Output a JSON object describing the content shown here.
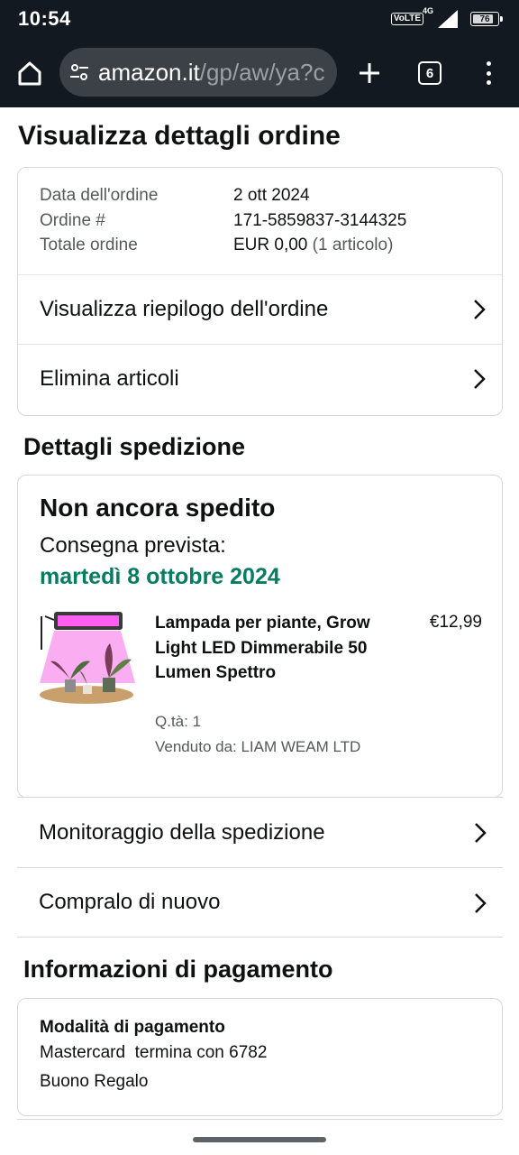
{
  "status_bar": {
    "time": "10:54",
    "volte": "VoLTE",
    "network": "4G",
    "battery": "76"
  },
  "browser": {
    "url_host": "amazon.it",
    "url_path": "/gp/aw/ya?c",
    "tab_count": "6",
    "icons": [
      "home-icon",
      "tune-icon",
      "plus-icon",
      "tabs-icon",
      "more-vert-icon"
    ]
  },
  "page": {
    "title": "Visualizza dettagli ordine"
  },
  "order": {
    "date_label": "Data dell'ordine",
    "date_value": "2 ott 2024",
    "number_label": "Ordine #",
    "number_value": "171-5859837-3144325",
    "total_label": "Totale ordine",
    "total_value": "EUR 0,00",
    "total_items": "(1 articolo)",
    "summary_link": "Visualizza riepilogo dell'ordine",
    "delete_link": "Elimina articoli"
  },
  "shipment": {
    "section_title": "Dettagli spedizione",
    "status": "Non ancora spedito",
    "delivery_label": "Consegna prevista:",
    "delivery_date": "martedì 8 ottobre 2024",
    "delivery_date_color": "#067d62",
    "product": {
      "title": "Lampada per piante, Grow Light LED Dimmerabile 50 Lumen Spettro",
      "price": "€12,99",
      "qty": "Q.tà: 1",
      "seller": "Venduto da: LIAM WEAM LTD"
    },
    "tracking_link": "Monitoraggio della spedizione",
    "buy_again_link": "Compralo di nuovo"
  },
  "payment": {
    "section_title": "Informazioni di pagamento",
    "method_title": "Modalità di pagamento",
    "card_brand": "Mastercard",
    "card_ending": "termina con 6782",
    "gift_card": "Buono Regalo"
  }
}
